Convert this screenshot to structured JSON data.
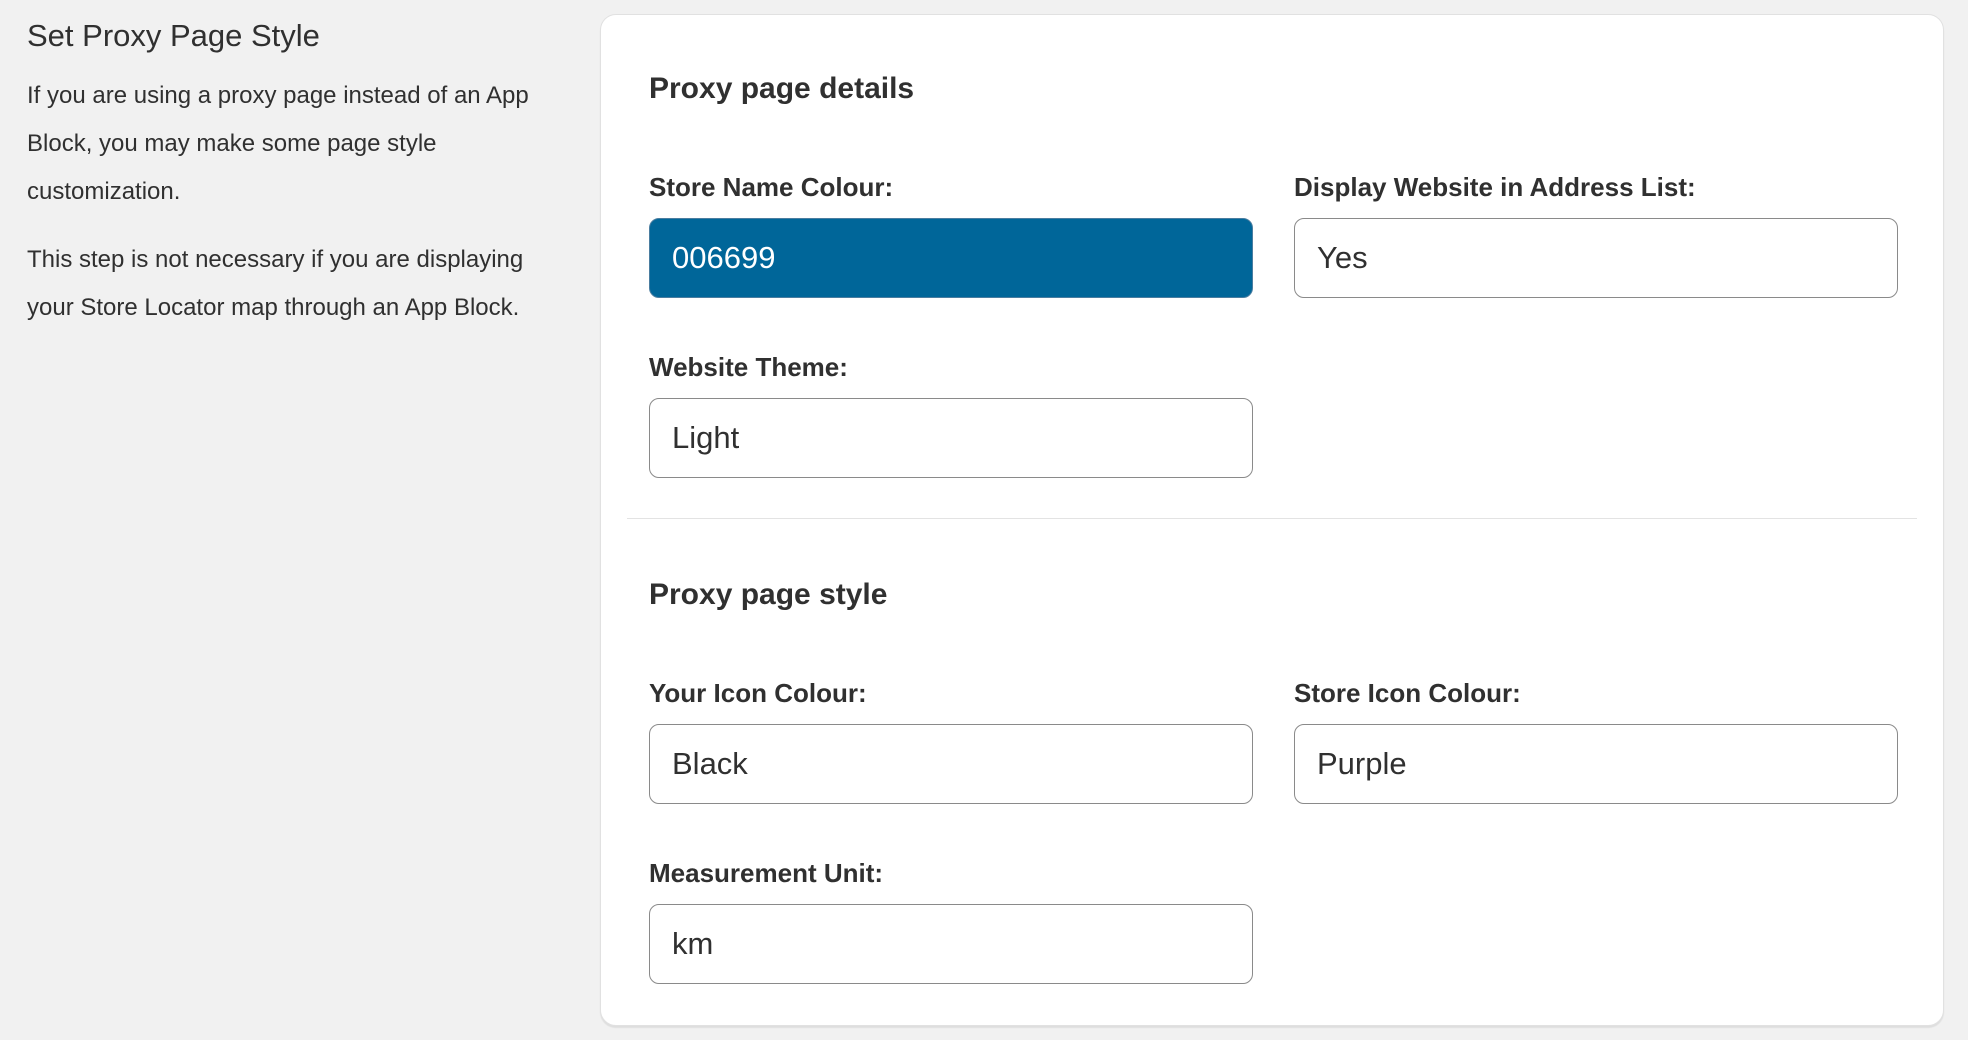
{
  "sidebar": {
    "heading": "Set Proxy Page Style",
    "paragraph_1": "If you are using a proxy page instead of an App Block, you may make some page style customization.",
    "paragraph_2": "This step is not necessary if you are displaying your Store Locator map through an App Block."
  },
  "details": {
    "title": "Proxy page details",
    "store_name_colour": {
      "label": "Store Name Colour:",
      "value": "006699",
      "swatch": "#006699"
    },
    "display_website": {
      "label": "Display Website in Address List:",
      "value": "Yes"
    },
    "website_theme": {
      "label": "Website Theme:",
      "value": "Light"
    }
  },
  "style": {
    "title": "Proxy page style",
    "your_icon_colour": {
      "label": "Your Icon Colour:",
      "value": "Black"
    },
    "store_icon_colour": {
      "label": "Store Icon Colour:",
      "value": "Purple"
    },
    "measurement_unit": {
      "label": "Measurement Unit:",
      "value": "km"
    }
  },
  "colors": {
    "page_background": "#f1f1f1",
    "card_background": "#ffffff",
    "text": "#303030",
    "field_border": "#8a8a8a"
  }
}
